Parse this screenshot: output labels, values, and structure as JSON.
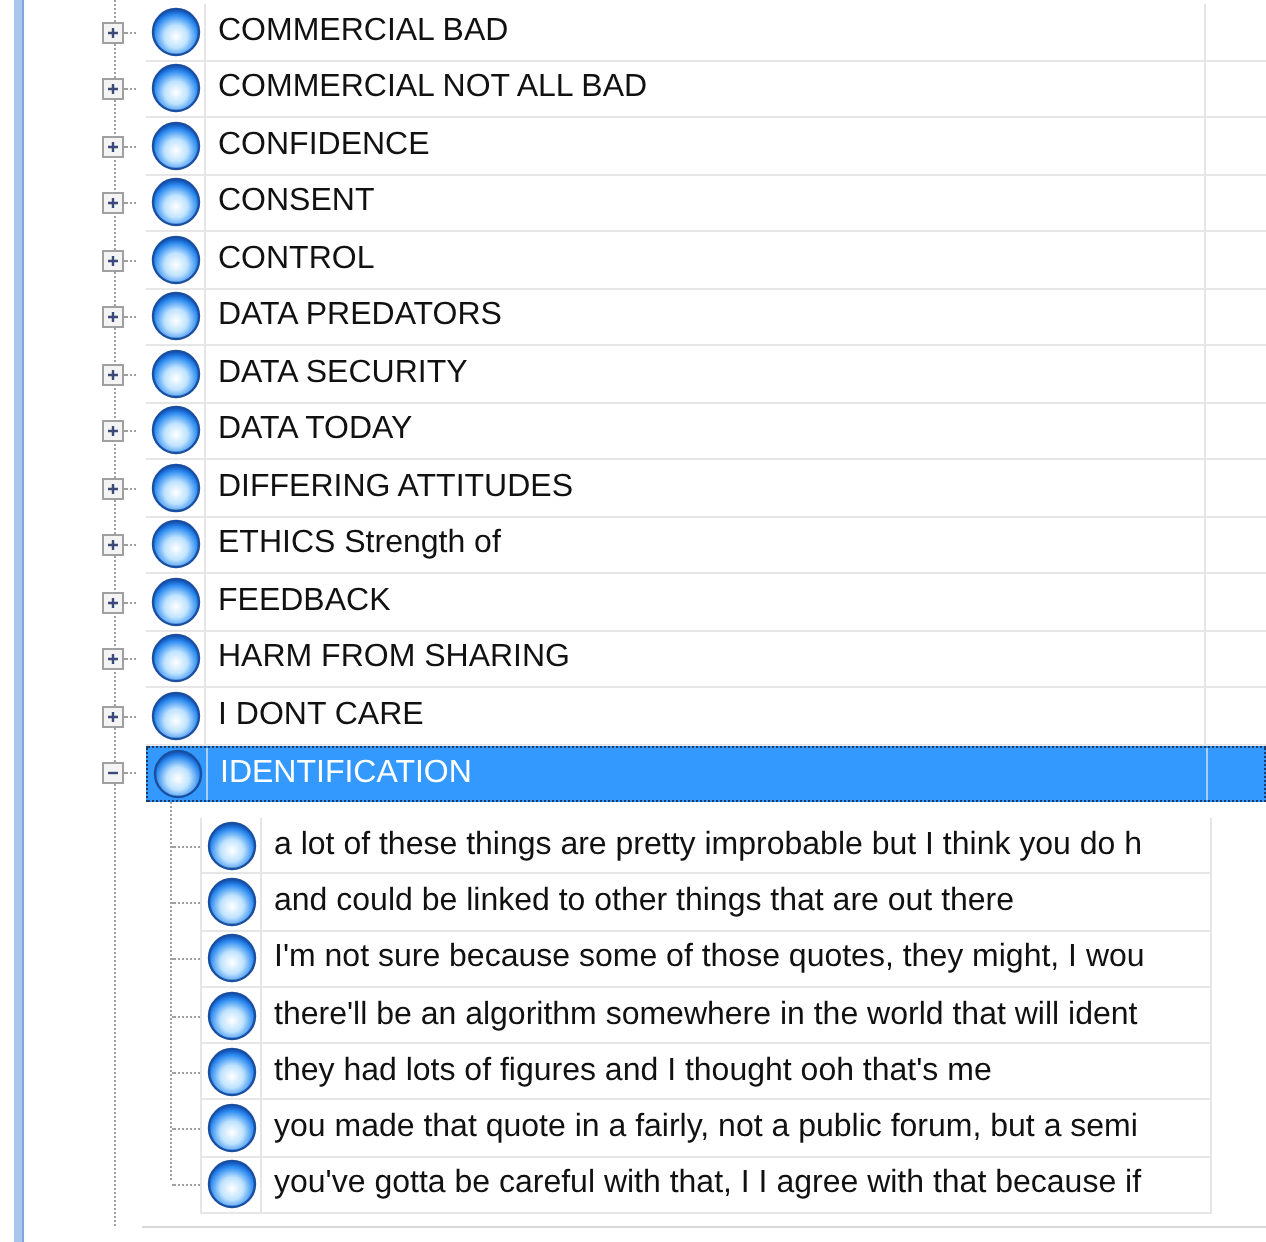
{
  "tree": [
    {
      "label": "COMMERCIAL BAD",
      "expanded": false,
      "selected": false
    },
    {
      "label": "COMMERCIAL NOT ALL BAD",
      "expanded": false,
      "selected": false
    },
    {
      "label": "CONFIDENCE",
      "expanded": false,
      "selected": false
    },
    {
      "label": "CONSENT",
      "expanded": false,
      "selected": false
    },
    {
      "label": "CONTROL",
      "expanded": false,
      "selected": false
    },
    {
      "label": "DATA PREDATORS",
      "expanded": false,
      "selected": false
    },
    {
      "label": "DATA SECURITY",
      "expanded": false,
      "selected": false
    },
    {
      "label": "DATA TODAY",
      "expanded": false,
      "selected": false
    },
    {
      "label": "DIFFERING ATTITUDES",
      "expanded": false,
      "selected": false
    },
    {
      "label": "ETHICS Strength of",
      "expanded": false,
      "selected": false
    },
    {
      "label": "FEEDBACK",
      "expanded": false,
      "selected": false
    },
    {
      "label": "HARM FROM SHARING",
      "expanded": false,
      "selected": false
    },
    {
      "label": "I DONT CARE",
      "expanded": false,
      "selected": false
    },
    {
      "label": "IDENTIFICATION",
      "expanded": true,
      "selected": true,
      "children": [
        {
          "label": "a lot of these things are pretty improbable but I think you do h",
          "selected": false
        },
        {
          "label": "and could be linked to other things that are out there",
          "selected": false
        },
        {
          "label": "I'm not sure because some of those quotes, they might, I wou",
          "selected": false
        },
        {
          "label": "there'll be an algorithm somewhere in the world that will ident",
          "selected": false
        },
        {
          "label": "they had lots of figures and I thought ooh that's me",
          "selected": false
        },
        {
          "label": "you made that quote in a fairly, not a public forum, but a semi",
          "selected": false
        },
        {
          "label": "you've gotta be careful with that, I I agree with that because if",
          "selected": false
        }
      ]
    }
  ]
}
